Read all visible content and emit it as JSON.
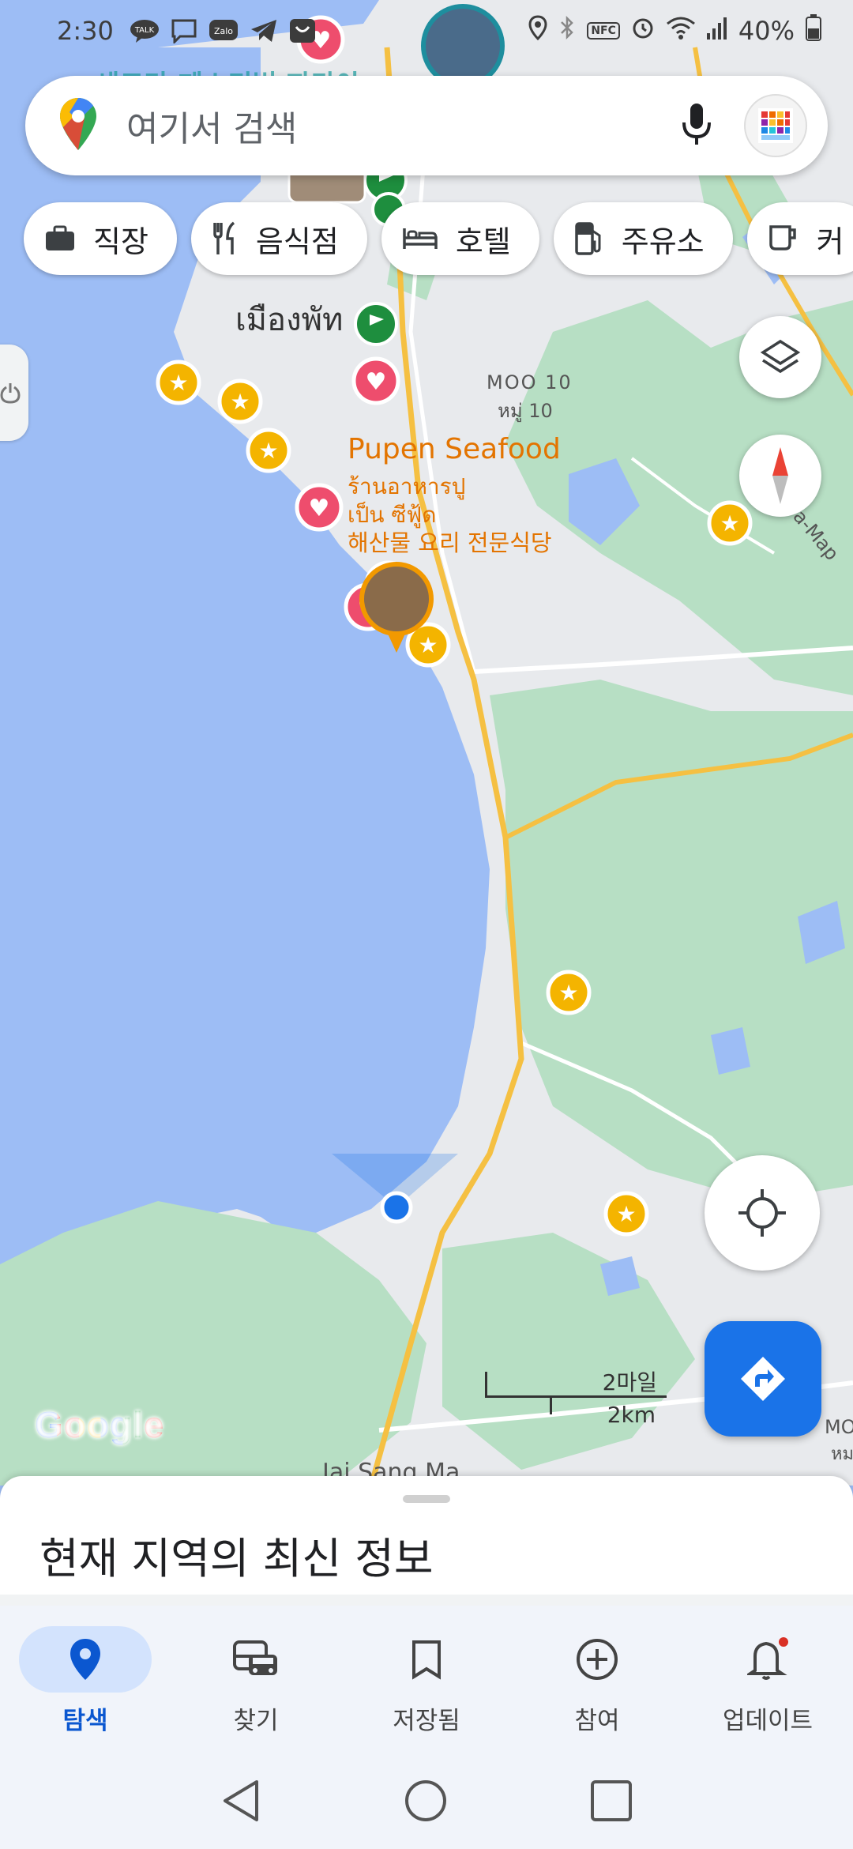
{
  "status_bar": {
    "time": "2:30",
    "battery": "40%",
    "app_icons": [
      "talk-icon",
      "message-icon",
      "zalo-icon",
      "telegram-icon",
      "shop-icon"
    ],
    "system_icons": [
      "location-icon",
      "bluetooth-icon",
      "nfc-icon",
      "alarm-icon",
      "wifi-icon",
      "signal-icon",
      "battery-icon"
    ],
    "nfc_label": "NFC"
  },
  "search": {
    "placeholder": "여기서 검색"
  },
  "chips": [
    {
      "label": "직장",
      "icon": "briefcase-icon"
    },
    {
      "label": "음식점",
      "icon": "restaurant-icon"
    },
    {
      "label": "호텔",
      "icon": "hotel-icon"
    },
    {
      "label": "주유소",
      "icon": "gas-station-icon"
    },
    {
      "label": "커",
      "icon": "coffee-icon"
    }
  ],
  "map": {
    "place_labels": {
      "area_korean_top": "세드라 페스티벌 파타야",
      "area_thai": "เมืองพัท",
      "moo_en": "MOO 10",
      "moo_th": "หมู่ 10",
      "restaurant_name": "Pupen Seafood",
      "restaurant_thai_1": "ร้านอาหารปู",
      "restaurant_thai_2": "เป็น ซีฟู้ด",
      "restaurant_korean": "해산물 요리 전문식당",
      "road_label": "a-Map",
      "bottom_place": "Jai Sang Ma",
      "moo_right": "MO",
      "moo_right_th": "หม"
    },
    "scale": {
      "miles": "2마일",
      "km": "2km"
    },
    "logo": "Google",
    "colors": {
      "water": "#9dbdf5",
      "land": "#e8eaed",
      "park": "#b7dfc4",
      "road_major": "#f5c042",
      "favorite_pin": "#ee4d6d",
      "star_pin": "#f4b400",
      "flag_pin": "#1e8e3e",
      "location_dot": "#1a73e8"
    }
  },
  "map_controls": {
    "layers": "layers-icon",
    "compass": "compass-icon",
    "my_location": "my-location-icon",
    "directions": "directions-icon"
  },
  "sheet": {
    "title": "현재 지역의 최신 정보"
  },
  "bottom_nav": [
    {
      "label": "탐색",
      "icon": "explore-pin-icon",
      "active": true
    },
    {
      "label": "찾기",
      "icon": "transit-icon",
      "active": false
    },
    {
      "label": "저장됨",
      "icon": "bookmark-icon",
      "active": false
    },
    {
      "label": "참여",
      "icon": "add-circle-icon",
      "active": false
    },
    {
      "label": "업데이트",
      "icon": "bell-icon",
      "active": false
    }
  ],
  "system_nav": [
    "back-icon",
    "home-icon",
    "recents-icon"
  ]
}
